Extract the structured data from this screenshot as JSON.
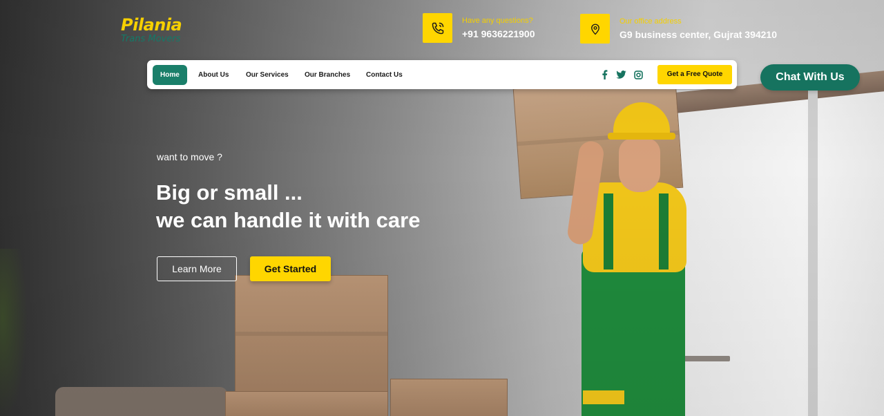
{
  "brand": {
    "name": "Pilania",
    "tagline": "Trans Movers"
  },
  "contact": {
    "phone": {
      "label": "Have any questions?",
      "value": "+91 9636221900",
      "icon": "phone-icon"
    },
    "address": {
      "label": "Our office address",
      "value": "G9 business center, Gujrat 394210",
      "icon": "location-pin-icon"
    }
  },
  "nav": {
    "items": [
      {
        "label": "Home",
        "active": true
      },
      {
        "label": "About Us",
        "active": false
      },
      {
        "label": "Our Services",
        "active": false
      },
      {
        "label": "Our Branches",
        "active": false
      },
      {
        "label": "Contact Us",
        "active": false
      }
    ],
    "social": [
      "facebook-icon",
      "twitter-icon",
      "instagram-icon"
    ],
    "quote_label": "Get a Free Quote"
  },
  "chat": {
    "label": "Chat With Us"
  },
  "hero": {
    "eyebrow": "want to move ?",
    "headline_line1": "Big or small ...",
    "headline_line2": "we can handle it with care",
    "learn_more": "Learn More",
    "get_started": "Get Started"
  },
  "colors": {
    "accent_yellow": "#ffd600",
    "brand_green": "#1a7f6a",
    "chat_green": "#16735f"
  }
}
